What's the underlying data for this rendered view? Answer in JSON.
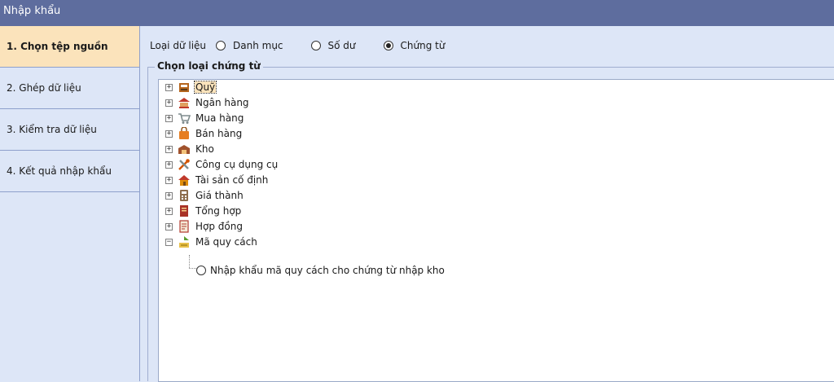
{
  "window": {
    "title": "Nhập khẩu"
  },
  "steps": [
    {
      "label": "1. Chọn tệp nguồn",
      "active": true
    },
    {
      "label": "2. Ghép dữ liệu"
    },
    {
      "label": "3. Kiểm tra dữ liệu"
    },
    {
      "label": "4. Kết quả nhập khẩu"
    }
  ],
  "data_type": {
    "label": "Loại dữ liệu",
    "options": [
      "Danh mục",
      "Số dư",
      "Chứng từ"
    ],
    "selected": "Chứng từ"
  },
  "voucher_group": {
    "legend": "Chọn loại chứng từ",
    "tree": [
      {
        "label": "Quỹ",
        "icon": "cash-register-icon",
        "color": "#b5651d",
        "selected": true
      },
      {
        "label": "Ngân hàng",
        "icon": "bank-icon",
        "color": "#c0392b"
      },
      {
        "label": "Mua hàng",
        "icon": "shopping-cart-icon",
        "color": "#7f8c8d"
      },
      {
        "label": "Bán hàng",
        "icon": "shopping-bag-icon",
        "color": "#e67e22"
      },
      {
        "label": "Kho",
        "icon": "warehouse-icon",
        "color": "#a0522d"
      },
      {
        "label": "Công cụ dụng cụ",
        "icon": "tools-icon",
        "color": "#d35400"
      },
      {
        "label": "Tài sản cố định",
        "icon": "house-icon",
        "color": "#e08e0b"
      },
      {
        "label": "Giá thành",
        "icon": "price-calculator-icon",
        "color": "#8e6e4e"
      },
      {
        "label": "Tổng hợp",
        "icon": "book-icon",
        "color": "#a93226"
      },
      {
        "label": "Hợp đồng",
        "icon": "contract-icon",
        "color": "#b03a2e"
      },
      {
        "label": "Mã quy cách",
        "icon": "spec-code-icon",
        "color": "#5a9e2f",
        "expanded": true,
        "children": [
          {
            "label": "Nhập khẩu mã quy cách cho chứng từ nhập kho"
          }
        ]
      }
    ]
  }
}
